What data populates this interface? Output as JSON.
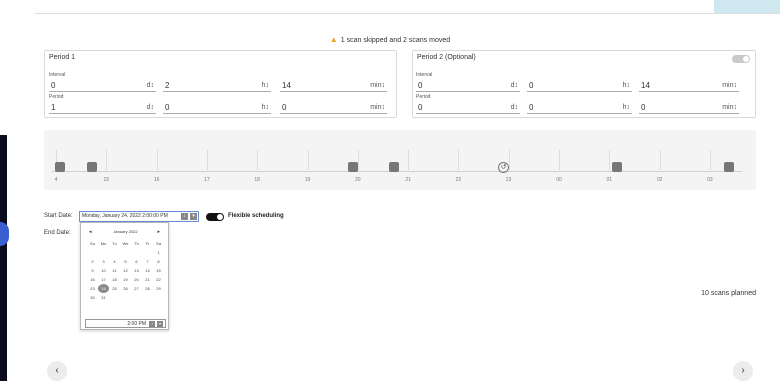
{
  "warning": {
    "icon": "warning-triangle-icon",
    "text": "1 scan skipped and 2 scans moved",
    "color": "#f0a020"
  },
  "period1": {
    "title": "Period 1",
    "interval_label": "Interval",
    "interval": {
      "d": "0",
      "h": "2",
      "min": "14"
    },
    "period_label": "Period",
    "period": {
      "d": "1",
      "h": "0",
      "min": "0"
    }
  },
  "period2": {
    "title": "Period 2 (Optional)",
    "interval_label": "Interval",
    "interval": {
      "d": "0",
      "h": "0",
      "min": "14"
    },
    "period_label": "Period",
    "period": {
      "d": "0",
      "h": "0",
      "min": "0"
    },
    "enabled": false
  },
  "units": {
    "d": "d↕",
    "h": "h↕",
    "min": "min↕"
  },
  "timeline": {
    "tick_labels": [
      "4",
      "15",
      "16",
      "17",
      "18",
      "19",
      "20",
      "21",
      "22",
      "23",
      "00",
      "01",
      "02",
      "03"
    ],
    "markers": 7,
    "history_icon": "↺"
  },
  "start_date": {
    "label": "Start Date:",
    "value": "Monday, January 24, 2022 2:00:00 PM",
    "spin": "↕",
    "drop": "▾"
  },
  "end_date": {
    "label": "End Date:"
  },
  "flexible": {
    "label": "Flexible scheduling",
    "enabled": true
  },
  "calendar": {
    "prev": "◂",
    "next": "▸",
    "month": "January 2022",
    "weekdays": [
      "Su",
      "Mo",
      "Tu",
      "We",
      "Th",
      "Fr",
      "Sa"
    ],
    "weeks": [
      [
        "",
        "",
        "",
        "",
        "",
        "",
        "1"
      ],
      [
        "2",
        "3",
        "4",
        "5",
        "6",
        "7",
        "8"
      ],
      [
        "9",
        "10",
        "11",
        "12",
        "13",
        "14",
        "15"
      ],
      [
        "16",
        "17",
        "18",
        "19",
        "20",
        "21",
        "22"
      ],
      [
        "23",
        "24",
        "25",
        "26",
        "27",
        "28",
        "29"
      ],
      [
        "30",
        "31",
        "",
        "",
        "",
        "",
        ""
      ]
    ],
    "selected": "24",
    "time": "2:00 PM"
  },
  "planned": "10 scans planned",
  "nav": {
    "prev": "‹",
    "next": "›"
  }
}
